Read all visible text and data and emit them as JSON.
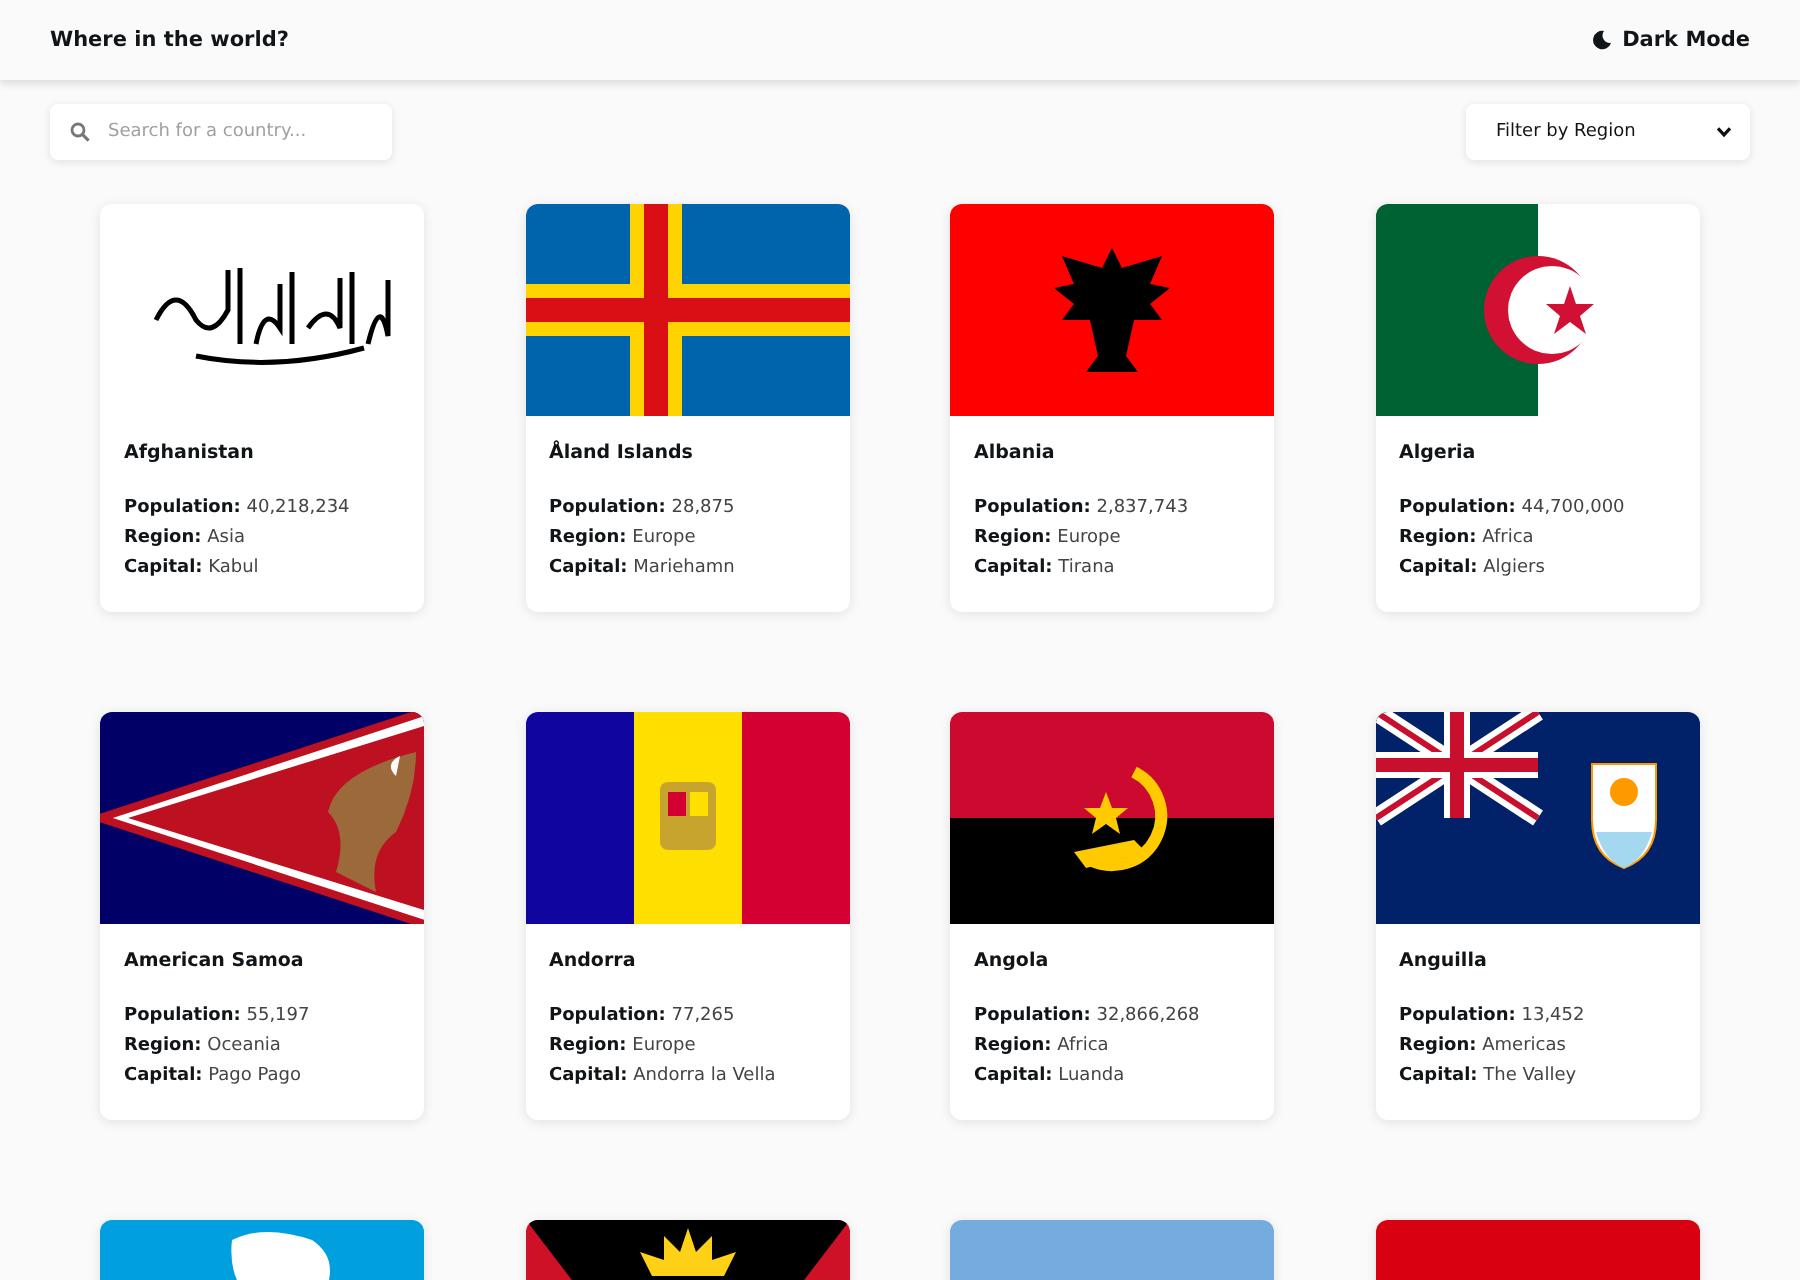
{
  "header": {
    "title": "Where in the world?",
    "theme_toggle": "Dark Mode"
  },
  "search": {
    "placeholder": "Search for a country..."
  },
  "region_filter": {
    "value": "Filter by Region"
  },
  "cards": [
    {
      "kind": "afghanistan",
      "name": "Afghanistan",
      "details": [
        "**Population:** 40,218,234",
        "**Region:** Asia",
        "**Capital:** Kabul"
      ]
    },
    {
      "kind": "aland",
      "name": "Åland Islands",
      "details": [
        "**Population:** 28,875",
        "**Region:** Europe",
        "**Capital:** Mariehamn"
      ]
    },
    {
      "kind": "albania",
      "name": "Albania",
      "details": [
        "**Population:** 2,837,743",
        "**Region:** Europe",
        "**Capital:** Tirana"
      ]
    },
    {
      "kind": "algeria",
      "name": "Algeria",
      "details": [
        "**Population:** 44,700,000",
        "**Region:** Africa",
        "**Capital:** Algiers"
      ]
    },
    {
      "kind": "american_samoa",
      "name": "American Samoa",
      "details": [
        "**Population:** 55,197",
        "**Region:** Oceania",
        "**Capital:** Pago Pago"
      ]
    },
    {
      "kind": "andorra",
      "name": "Andorra",
      "details": [
        "**Population:** 77,265",
        "**Region:** Europe",
        "**Capital:** Andorra la Vella"
      ]
    },
    {
      "kind": "angola",
      "name": "Angola",
      "details": [
        "**Population:** 32,866,268",
        "**Region:** Africa",
        "**Capital:** Luanda"
      ]
    },
    {
      "kind": "anguilla",
      "name": "Anguilla",
      "details": [
        "**Population:** 13,452",
        "**Region:** Americas",
        "**Capital:** The Valley"
      ]
    },
    {
      "kind": "antarctica"
    },
    {
      "kind": "antigua"
    },
    {
      "kind": "light_blue"
    },
    {
      "kind": "red"
    }
  ]
}
